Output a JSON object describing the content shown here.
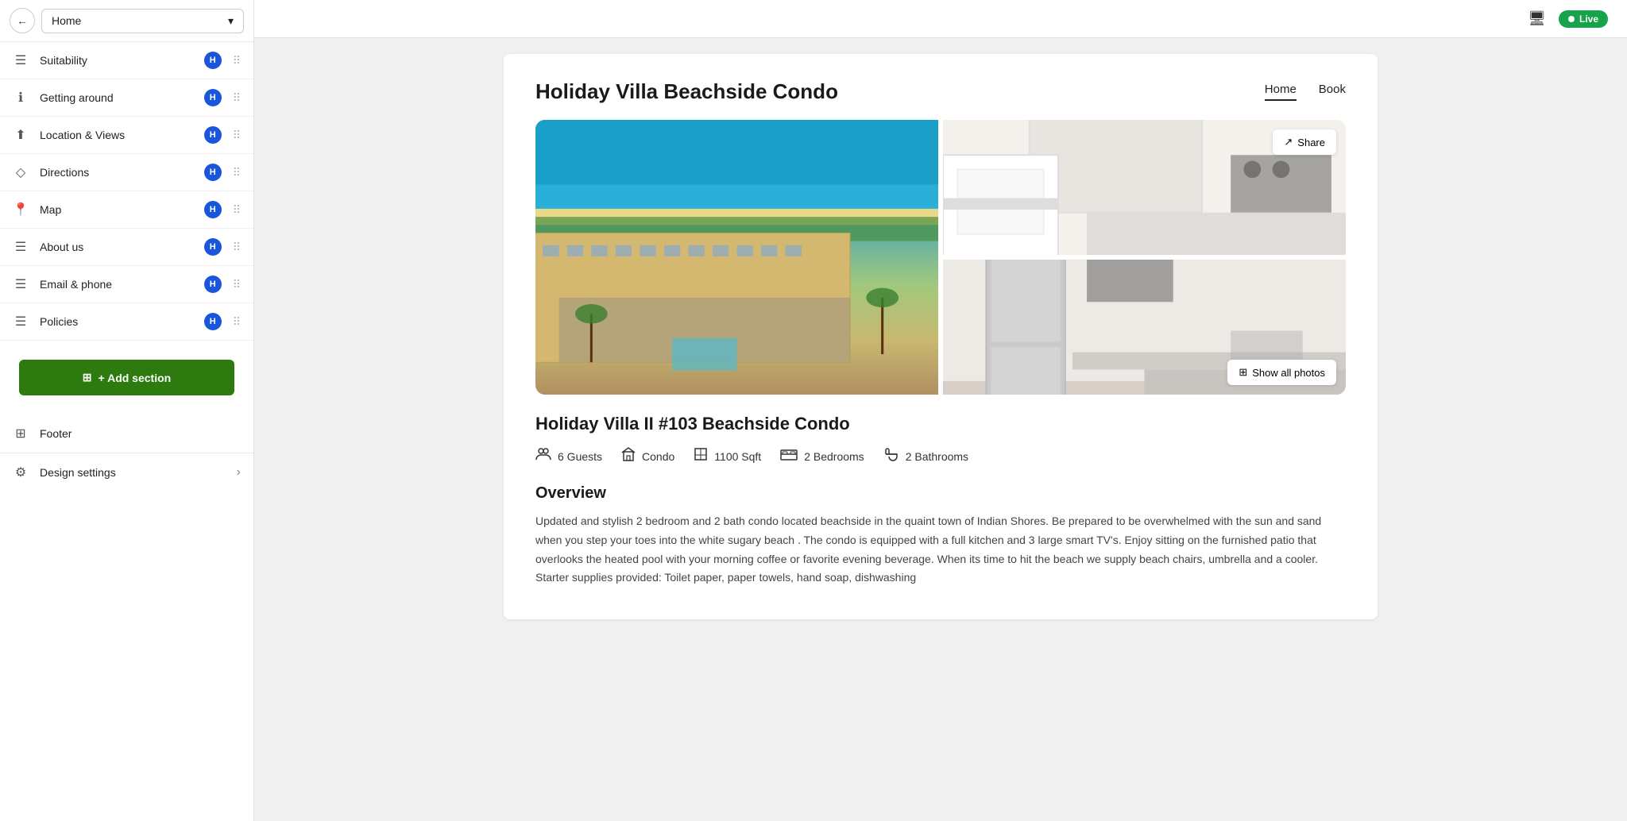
{
  "topbar": {
    "live_label": "Live"
  },
  "sidebar": {
    "home_dropdown": "Home",
    "items": [
      {
        "id": "suitability",
        "label": "Suitability",
        "icon": "☰"
      },
      {
        "id": "getting-around",
        "label": "Getting around",
        "icon": "ℹ"
      },
      {
        "id": "location-views",
        "label": "Location & Views",
        "icon": "⬆"
      },
      {
        "id": "directions",
        "label": "Directions",
        "icon": "◇"
      },
      {
        "id": "map",
        "label": "Map",
        "icon": "📍"
      },
      {
        "id": "about-us",
        "label": "About us",
        "icon": "☰"
      },
      {
        "id": "email-phone",
        "label": "Email & phone",
        "icon": "☰"
      },
      {
        "id": "policies",
        "label": "Policies",
        "icon": "☰"
      }
    ],
    "add_section_label": "+ Add section",
    "footer_label": "Footer",
    "footer_icon": "⊞",
    "design_settings_label": "Design settings"
  },
  "page": {
    "title": "Holiday Villa Beachside Condo",
    "nav": [
      {
        "label": "Home",
        "active": true
      },
      {
        "label": "Book",
        "active": false
      }
    ],
    "condo_title": "Holiday Villa II #103 Beachside Condo",
    "amenities": [
      {
        "icon": "👥",
        "label": "6 Guests"
      },
      {
        "icon": "🏠",
        "label": "Condo"
      },
      {
        "icon": "📐",
        "label": "1100 Sqft"
      },
      {
        "icon": "🛏",
        "label": "2 Bedrooms"
      },
      {
        "icon": "🛁",
        "label": "2 Bathrooms"
      }
    ],
    "overview_title": "Overview",
    "overview_text": "Updated and stylish 2 bedroom and 2 bath condo located beachside in the quaint town of Indian Shores. Be prepared to be overwhelmed with the sun and sand when you step your toes into the white sugary beach . The condo is equipped with a full kitchen and 3 large smart TV's. Enjoy sitting on the furnished patio that overlooks the heated pool with your morning coffee or favorite evening beverage. When its time to hit the beach we supply beach chairs, umbrella and a cooler. Starter supplies provided: Toilet paper, paper towels, hand soap, dishwashing",
    "share_label": "Share",
    "show_all_label": "Show all photos",
    "share_icon": "↗",
    "grid_icon": "⊞"
  }
}
